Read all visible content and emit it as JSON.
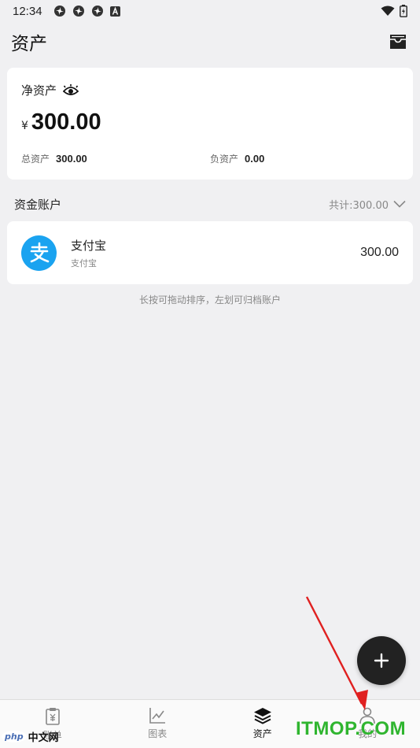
{
  "status_bar": {
    "time": "12:34",
    "left_icons": [
      "pinwheel-icon",
      "pinwheel-icon",
      "pinwheel-icon",
      "a-badge-icon"
    ],
    "right_icons": [
      "wifi-icon",
      "battery-icon"
    ]
  },
  "header": {
    "title": "资产",
    "action_icon": "archive-box-icon"
  },
  "net_worth": {
    "label": "净资产",
    "eye_icon": "eye-icon",
    "currency": "¥",
    "amount": "300.00",
    "total_assets_label": "总资产",
    "total_assets_value": "300.00",
    "liabilities_label": "负资产",
    "liabilities_value": "0.00"
  },
  "accounts_section": {
    "title": "资金账户",
    "total_text": "共计:300.00",
    "accounts": [
      {
        "name": "支付宝",
        "subtitle": "支付宝",
        "balance": "300.00",
        "logo_char": "支",
        "logo_color": "#1aa3f0"
      }
    ],
    "hint": "长按可拖动排序，左划可归档账户"
  },
  "fab": {
    "icon": "plus-icon"
  },
  "bottom_nav": {
    "active": "资产",
    "items": [
      {
        "label": "账单",
        "icon": "bill-icon"
      },
      {
        "label": "图表",
        "icon": "chart-icon"
      },
      {
        "label": "资产",
        "icon": "layers-icon"
      },
      {
        "label": "我的",
        "icon": "person-icon"
      }
    ]
  },
  "watermarks": {
    "site": "ITMOP.COM",
    "php_badge": "php",
    "php_text": "中文网"
  },
  "colors": {
    "background": "#f0f0f2",
    "card": "#ffffff",
    "alipay_blue": "#1aa3f0",
    "fab": "#222222",
    "watermark_green": "#2fb52f",
    "arrow_red": "#e02020"
  }
}
